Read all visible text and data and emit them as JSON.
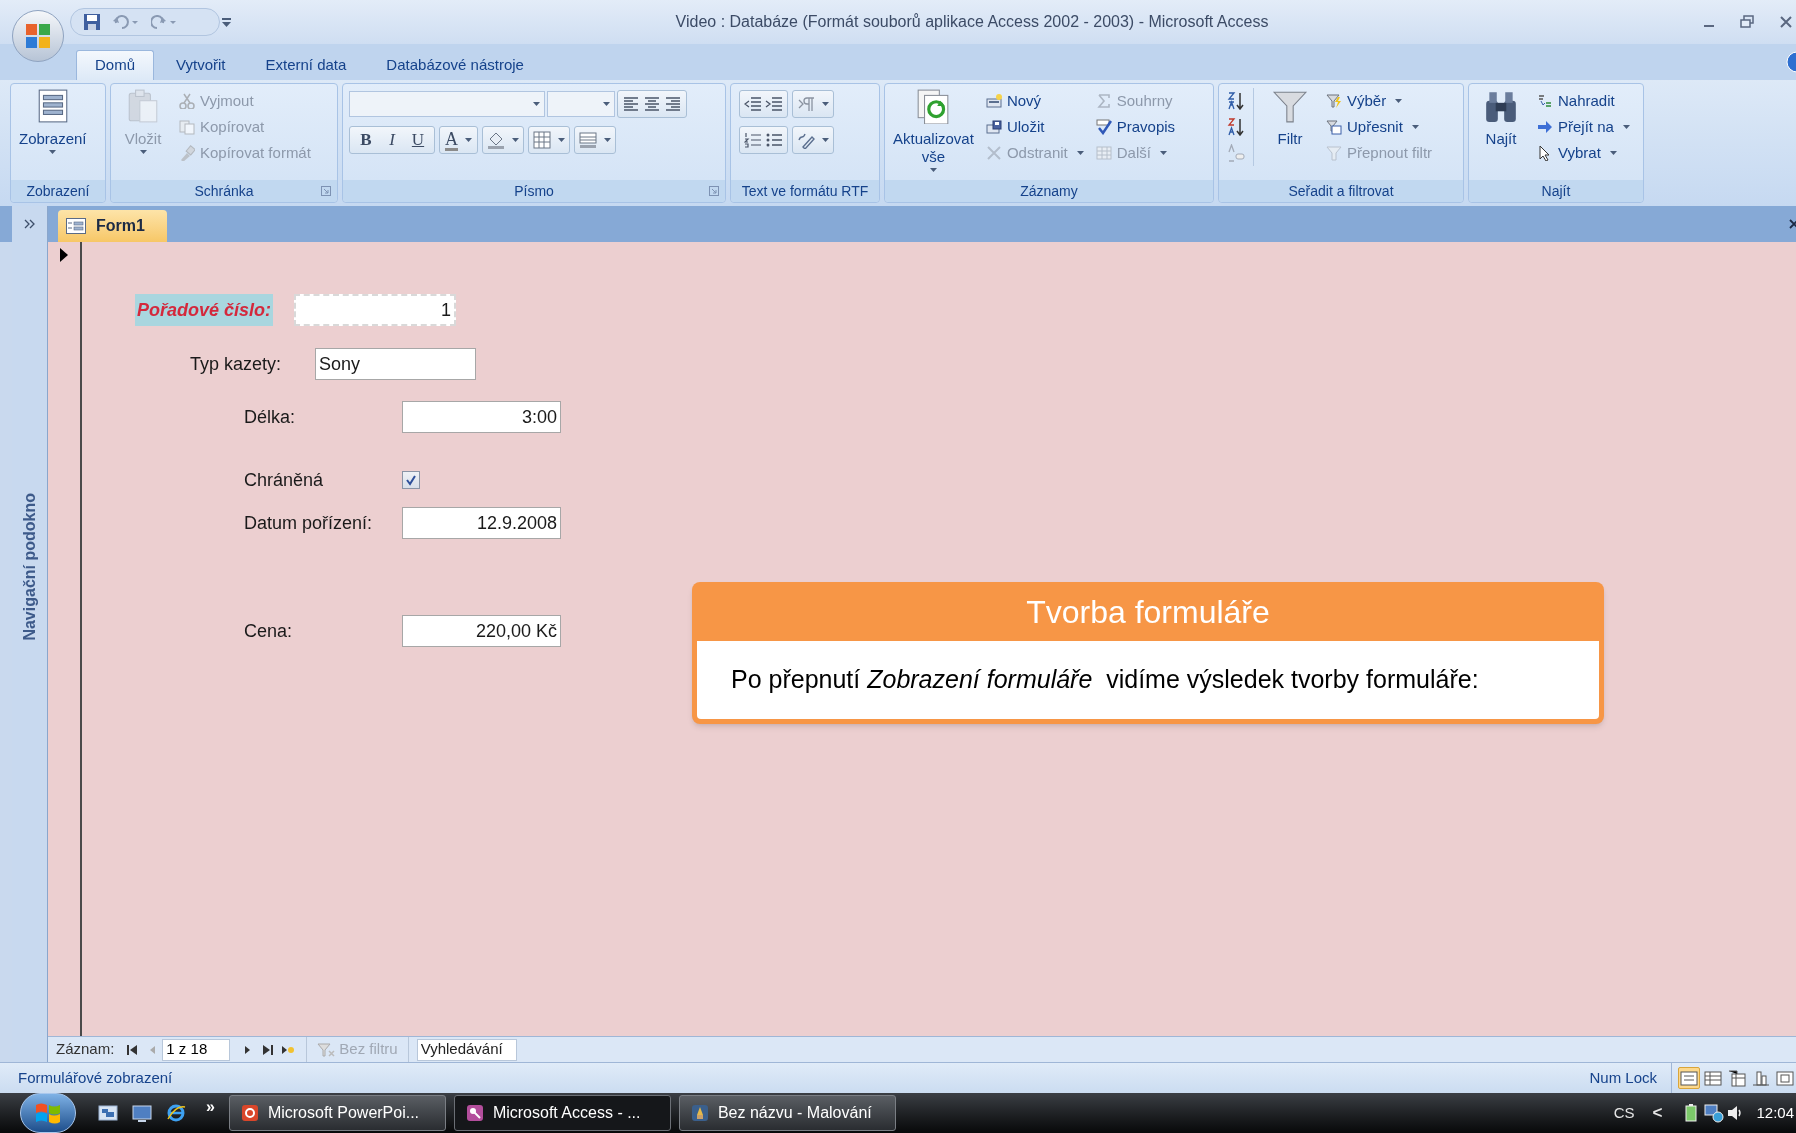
{
  "window": {
    "title": "Video : Databáze (Formát souborů aplikace Access 2002 - 2003) - Microsoft Access"
  },
  "ribbon_tabs": [
    {
      "label": "Domů",
      "selected": true
    },
    {
      "label": "Vytvořit",
      "selected": false
    },
    {
      "label": "Externí data",
      "selected": false
    },
    {
      "label": "Databázové nástroje",
      "selected": false
    }
  ],
  "ribbon_groups": [
    {
      "title": "Zobrazení",
      "kind": "plain",
      "columns": [
        {
          "kind": "large",
          "label": "Zobrazení",
          "disabled": false,
          "dropdown": true
        }
      ]
    },
    {
      "title": "Schránka",
      "kind": "plain",
      "columns": [
        {
          "kind": "large",
          "label": "Vložit",
          "disabled": true,
          "dropdown": true
        },
        {
          "kind": "small",
          "items": [
            {
              "label": "Vyjmout",
              "disabled": true,
              "dropdown": false
            },
            {
              "label": "Kopírovat",
              "disabled": true,
              "dropdown": false
            },
            {
              "label": "Kopírovat formát",
              "disabled": true,
              "dropdown": false
            }
          ]
        }
      ]
    },
    {
      "title": "Písmo",
      "kind": "font",
      "letters": [
        "B",
        "I",
        "U",
        "A"
      ]
    },
    {
      "title": "Text ve formátu RTF",
      "kind": "rtf"
    },
    {
      "title": "Záznamy",
      "kind": "plain",
      "columns": [
        {
          "kind": "large",
          "label": "Aktualizovat vše",
          "disabled": false,
          "dropdown": true
        },
        {
          "kind": "small",
          "items": [
            {
              "label": "Nový",
              "disabled": false,
              "dropdown": false
            },
            {
              "label": "Uložit",
              "disabled": false,
              "dropdown": false
            },
            {
              "label": "Odstranit",
              "disabled": true,
              "dropdown": true
            }
          ]
        },
        {
          "kind": "small",
          "items": [
            {
              "label": "Souhrny",
              "disabled": true,
              "dropdown": false
            },
            {
              "label": "Pravopis",
              "disabled": false,
              "dropdown": false
            },
            {
              "label": "Další",
              "disabled": true,
              "dropdown": true
            }
          ]
        }
      ]
    },
    {
      "title": "Seřadit a filtrovat",
      "kind": "plain",
      "columns": [
        {
          "kind": "icons"
        },
        {
          "kind": "large",
          "label": "Filtr",
          "disabled": false,
          "dropdown": false
        },
        {
          "kind": "small",
          "items": [
            {
              "label": "Výběr",
              "disabled": false,
              "dropdown": true
            },
            {
              "label": "Upřesnit",
              "disabled": false,
              "dropdown": true
            },
            {
              "label": "Přepnout filtr",
              "disabled": true,
              "dropdown": false
            }
          ]
        }
      ]
    },
    {
      "title": "Najít",
      "kind": "plain",
      "columns": [
        {
          "kind": "large",
          "label": "Najít",
          "disabled": false,
          "dropdown": false
        },
        {
          "kind": "small",
          "items": [
            {
              "label": "Nahradit",
              "disabled": false,
              "dropdown": false
            },
            {
              "label": "Přejít na",
              "disabled": false,
              "dropdown": true
            },
            {
              "label": "Vybrat",
              "disabled": false,
              "dropdown": true
            }
          ]
        }
      ]
    }
  ],
  "nav_pane": {
    "label": "Navigační podokno"
  },
  "document_tabs": [
    {
      "label": "Form1",
      "selected": true
    }
  ],
  "form_fields": [
    {
      "kind": "number",
      "label": "Pořadové číslo:",
      "value": "1",
      "focused": true
    },
    {
      "kind": "text",
      "label": "Typ kazety:",
      "value": "Sony",
      "focused": false
    },
    {
      "kind": "number",
      "label": "Délka:",
      "value": "3:00",
      "focused": false
    },
    {
      "kind": "checkbox",
      "label": "Chráněná",
      "checked": true,
      "focused": false
    },
    {
      "kind": "number",
      "label": "Datum pořízení:",
      "value": "12.9.2008",
      "focused": false
    },
    {
      "kind": "number",
      "label": "Cena:",
      "value": "220,00 Kč",
      "focused": false
    }
  ],
  "callout": {
    "title": "Tvorba formuláře",
    "text": "Po přepnutí *Zobrazení formuláře*  vidíme výsledek tvorby formuláře:"
  },
  "record_navigator": {
    "label": "Záznam:",
    "position": "1 z 18",
    "filter": "Bez filtru",
    "search_placeholder": "Vyhledávání"
  },
  "status_bar": {
    "text": "Formulářové zobrazení",
    "indicator": "Num Lock",
    "views": [
      {
        "selected": true
      },
      {
        "selected": false
      },
      {
        "selected": false
      },
      {
        "selected": false
      },
      {
        "selected": false
      }
    ]
  },
  "taskbar": {
    "overflow": "»",
    "tasks": [
      {
        "label": "Microsoft PowerPoi...",
        "selected": false
      },
      {
        "label": "Microsoft Access - ...",
        "selected": true
      },
      {
        "label": "Bez názvu - Malování",
        "selected": false
      }
    ],
    "language": "CS",
    "tray_toggle": "<",
    "clock": "12:04"
  }
}
